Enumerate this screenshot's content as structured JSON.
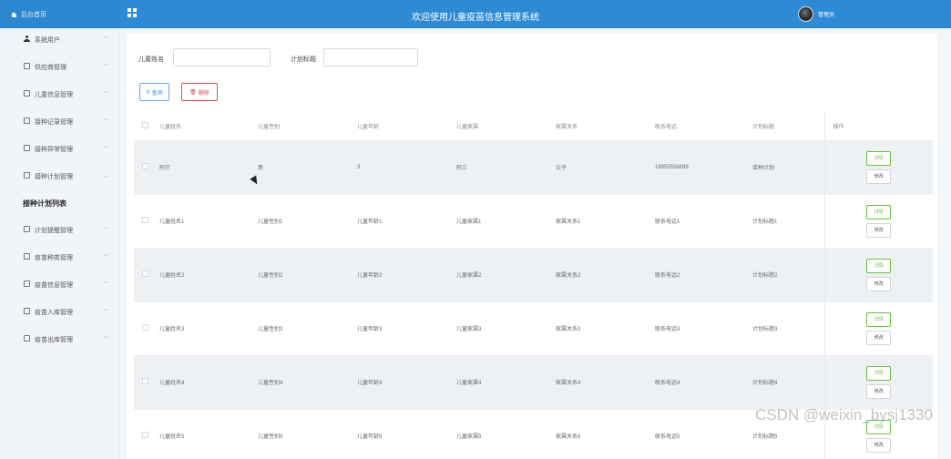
{
  "header": {
    "home_label": "后台首页",
    "title": "欢迎使用儿童疫苗信息管理系统",
    "user_name": "管理员"
  },
  "sidebar": {
    "items": [
      {
        "label": "系统用户",
        "icon": "user-icon",
        "expanded": false
      },
      {
        "label": "供应商管理",
        "icon": "menu-box-icon",
        "expanded": false
      },
      {
        "label": "儿童信息管理",
        "icon": "menu-box-icon",
        "expanded": false
      },
      {
        "label": "接种记录管理",
        "icon": "menu-box-icon",
        "expanded": false
      },
      {
        "label": "接种异常管理",
        "icon": "menu-box-icon",
        "expanded": false
      },
      {
        "label": "接种计划管理",
        "icon": "menu-box-icon",
        "expanded": true
      },
      {
        "label": "计划提醒管理",
        "icon": "menu-box-icon",
        "expanded": false
      },
      {
        "label": "疫苗种类管理",
        "icon": "menu-box-icon",
        "expanded": false
      },
      {
        "label": "疫苗信息管理",
        "icon": "menu-box-icon",
        "expanded": false
      },
      {
        "label": "疫苗入库管理",
        "icon": "menu-box-icon",
        "expanded": false
      },
      {
        "label": "疫苗出库管理",
        "icon": "menu-box-icon",
        "expanded": false
      }
    ],
    "active_submenu": "接种计划列表"
  },
  "filters": {
    "child_name_label": "儿童姓名",
    "child_name_value": "",
    "plan_title_label": "计划标题",
    "plan_title_value": ""
  },
  "actions": {
    "search_label": "查询",
    "delete_label": "删除"
  },
  "table": {
    "columns": [
      "儿童姓名",
      "儿童性别",
      "儿童年龄",
      "儿童家属",
      "家属关系",
      "联系电话",
      "计划标题",
      "操作"
    ],
    "rows": [
      [
        "阿尔",
        "男",
        "3",
        "阿三",
        "父子",
        "18955556699",
        "接种计划"
      ],
      [
        "儿童姓名1",
        "儿童性别1",
        "儿童年龄1",
        "儿童家属1",
        "家属关系1",
        "联系电话1",
        "计划标题1"
      ],
      [
        "儿童姓名2",
        "儿童性别2",
        "儿童年龄2",
        "儿童家属2",
        "家属关系2",
        "联系电话2",
        "计划标题2"
      ],
      [
        "儿童姓名3",
        "儿童性别3",
        "儿童年龄3",
        "儿童家属3",
        "家属关系3",
        "联系电话3",
        "计划标题3"
      ],
      [
        "儿童姓名4",
        "儿童性别4",
        "儿童年龄4",
        "儿童家属4",
        "家属关系4",
        "联系电话4",
        "计划标题4"
      ],
      [
        "儿童姓名5",
        "儿童性别5",
        "儿童年龄5",
        "儿童家属5",
        "家属关系5",
        "联系电话5",
        "计划标题5"
      ]
    ],
    "detail_label": "详情",
    "edit_label": "修改"
  },
  "watermark": "CSDN @weixin_bysj1330",
  "colors": {
    "header_bg": "#2d8bd6",
    "detail_green": "#67c23a",
    "delete_red": "#e24b4b",
    "search_blue": "#3b8fd8"
  }
}
